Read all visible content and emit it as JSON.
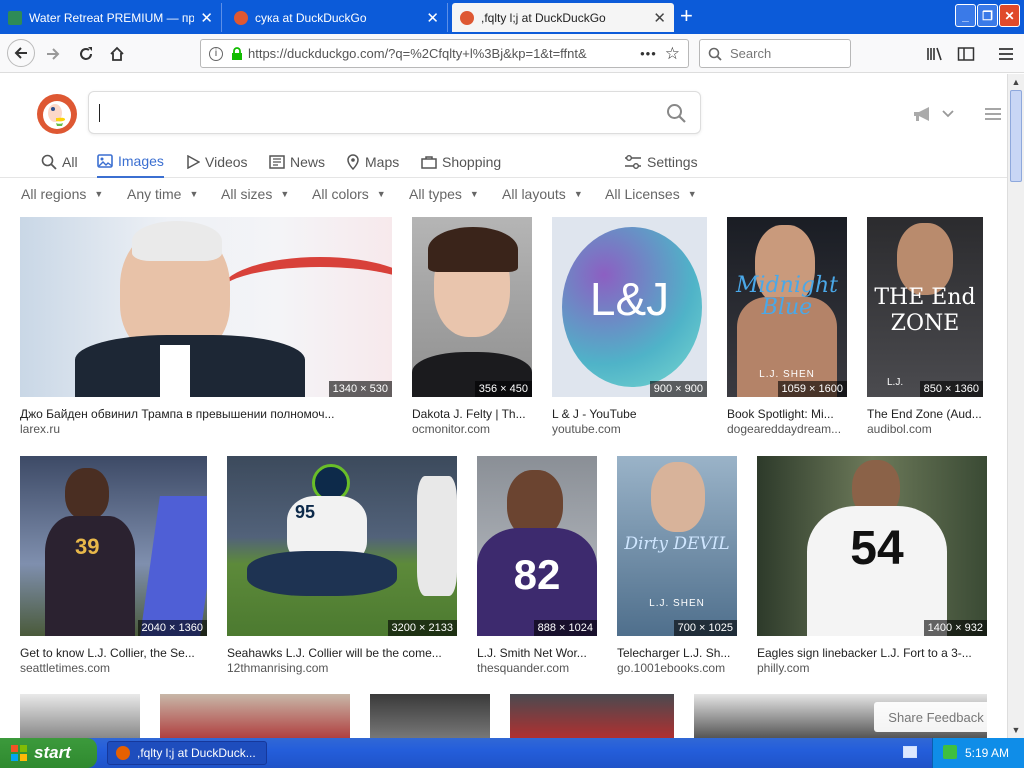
{
  "browser": {
    "tabs": [
      {
        "label": "Water Retreat PREMIUM — прило",
        "icon": "spreadsheet-icon"
      },
      {
        "label": "сука at DuckDuckGo",
        "icon": "duckduckgo-icon"
      },
      {
        "label": ",fqlty l;j at DuckDuckGo",
        "icon": "duckduckgo-icon"
      }
    ],
    "new_tab": "+",
    "url": "https://duckduckgo.com/?q=%2Cfqlty+l%3Bj&kp=1&t=ffnt&",
    "url_more": "•••",
    "search_placeholder": "Search",
    "window_min": "_",
    "window_max": "❐",
    "window_close": "✕"
  },
  "ddg": {
    "nav_tabs": [
      {
        "label": "All"
      },
      {
        "label": "Images"
      },
      {
        "label": "Videos"
      },
      {
        "label": "News"
      },
      {
        "label": "Maps"
      },
      {
        "label": "Shopping"
      }
    ],
    "settings_label": "Settings",
    "filters": [
      "All regions",
      "Any time",
      "All sizes",
      "All colors",
      "All types",
      "All layouts",
      "All Licenses"
    ],
    "share_feedback": "Share Feedback"
  },
  "results": [
    {
      "title": "Джо Байден обвинил Трампа в превышении полномоч...",
      "source": "larex.ru",
      "dims": "1340 × 530"
    },
    {
      "title": "Dakota J. Felty | Th...",
      "source": "ocmonitor.com",
      "dims": "356 × 450"
    },
    {
      "title": "L & J - YouTube",
      "source": "youtube.com",
      "dims": "900 × 900",
      "image_text": "L&J"
    },
    {
      "title": "Book Spotlight: Mi...",
      "source": "dogeareddaydream...",
      "dims": "1059 × 1600",
      "image_text": "Midnight Blue",
      "image_author": "L.J. SHEN"
    },
    {
      "title": "The End Zone (Aud...",
      "source": "audibol.com",
      "dims": "850 × 1360",
      "image_text": "THE End ZONE",
      "image_author": "L.J."
    },
    {
      "title": "Get to know L.J. Collier, the Se...",
      "source": "seattletimes.com",
      "dims": "2040 × 1360",
      "image_text": "39"
    },
    {
      "title": "Seahawks L.J. Collier will be the come...",
      "source": "12thmanrising.com",
      "dims": "3200 × 2133",
      "image_text": "95"
    },
    {
      "title": "L.J. Smith Net Wor...",
      "source": "thesquander.com",
      "dims": "888 × 1024",
      "image_text": "82"
    },
    {
      "title": "Telecharger L.J. Sh...",
      "source": "go.1001ebooks.com",
      "dims": "700 × 1025",
      "image_text": "Dirty DEVIL",
      "image_author": "L.J. SHEN"
    },
    {
      "title": "Eagles sign linebacker L.J. Fort to a 3-...",
      "source": "philly.com",
      "dims": "1400 × 932",
      "image_text": "54"
    }
  ],
  "taskbar": {
    "start": "start",
    "task_label": ",fqlty l;j at DuckDuck...",
    "clock": "5:19 AM"
  },
  "colors": {
    "accent": "#3b6fd1",
    "ddg_orange": "#de5833",
    "xp_blue": "#245edb",
    "xp_green": "#3c9a3c"
  }
}
